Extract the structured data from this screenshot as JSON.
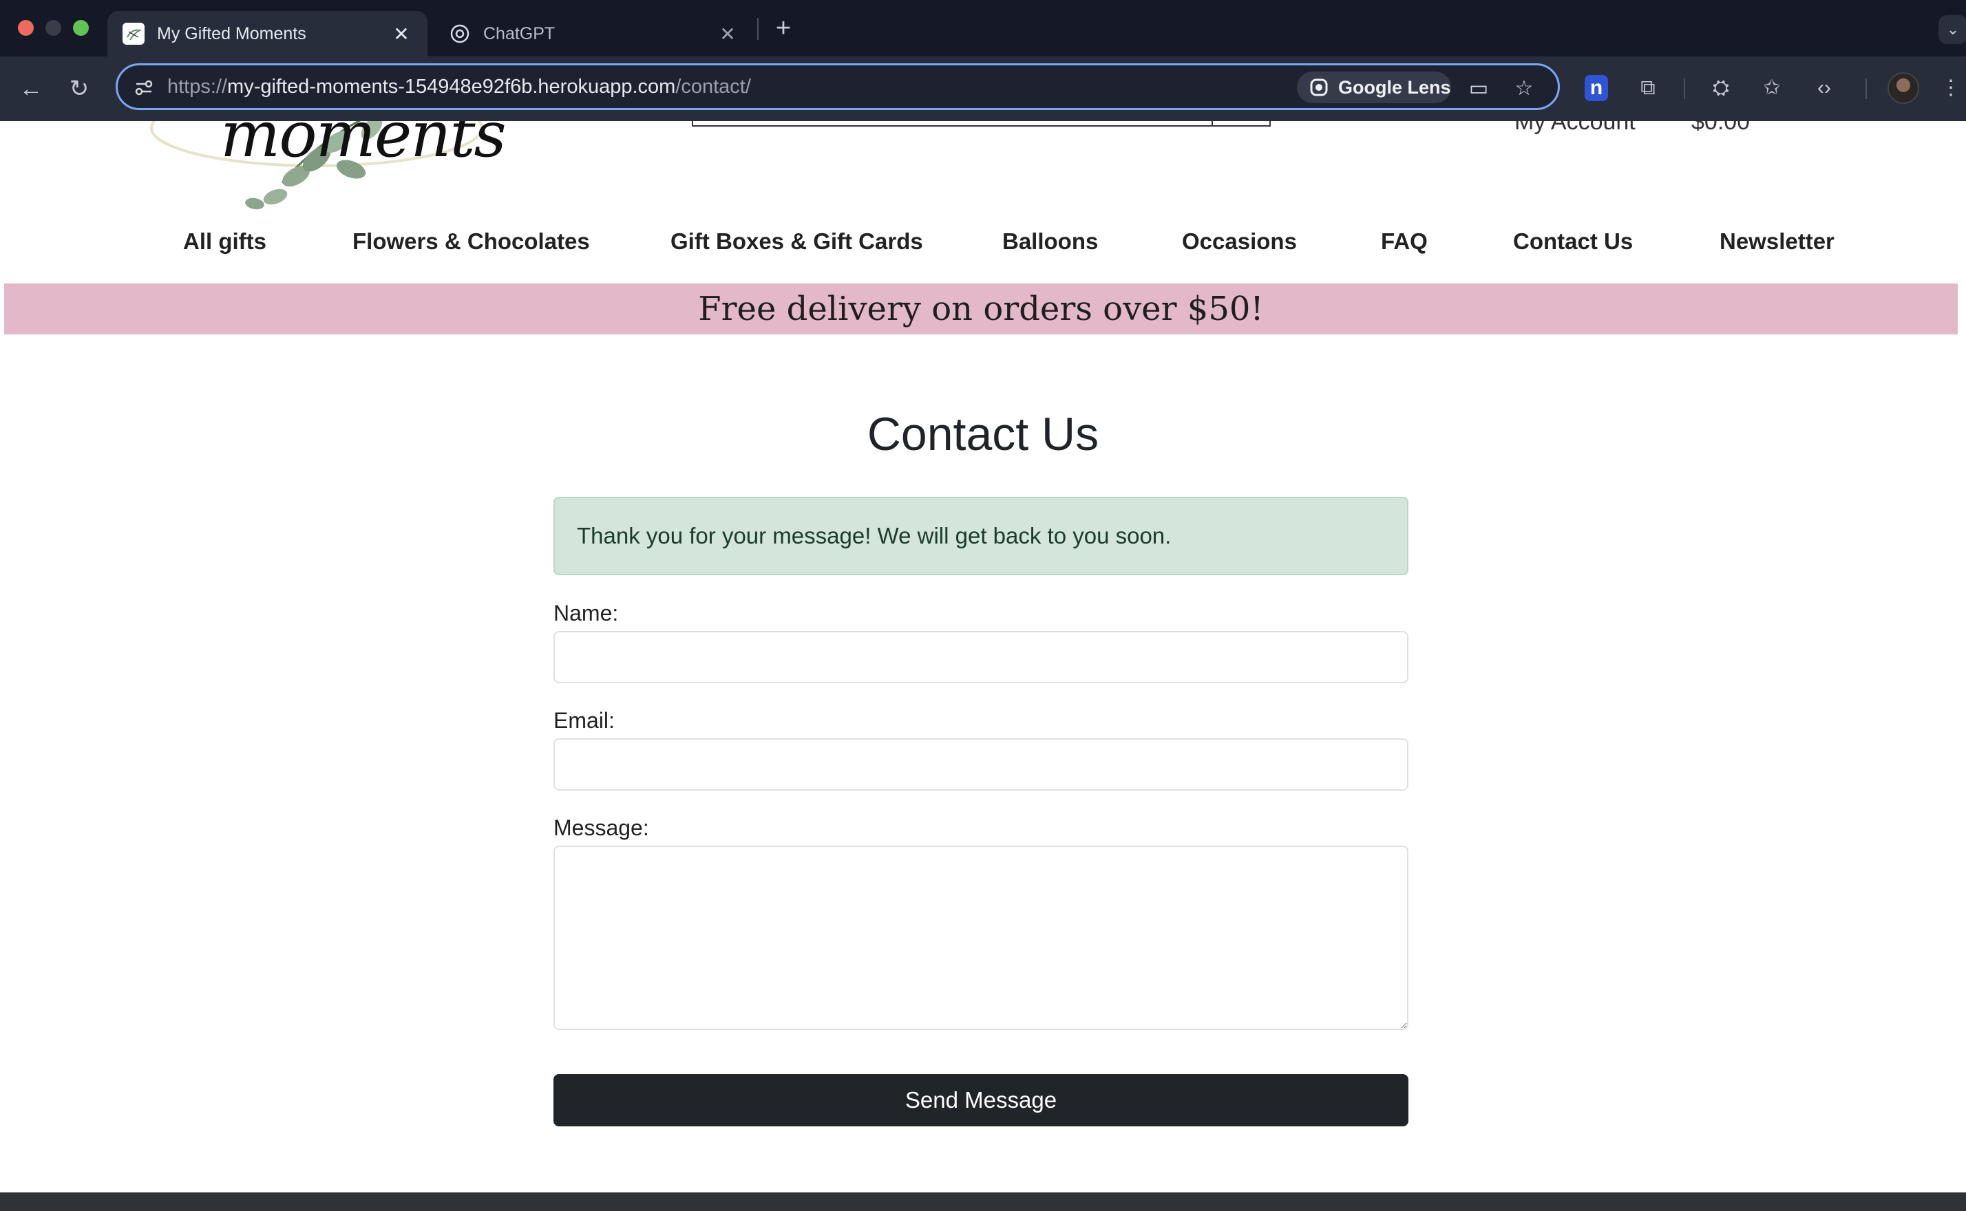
{
  "browser": {
    "tabs": [
      {
        "title": "My Gifted Moments",
        "active": true
      },
      {
        "title": "ChatGPT",
        "active": false
      }
    ],
    "url": {
      "scheme": "https://",
      "host": "my-gifted-moments-154948e92f6b.herokuapp.com",
      "path": "/contact/"
    },
    "lens_label": "Google Lens"
  },
  "site": {
    "logo_text": "moments",
    "account_label": "My Account",
    "cart_total": "$0.00",
    "nav": [
      "All gifts",
      "Flowers & Chocolates",
      "Gift Boxes & Gift Cards",
      "Balloons",
      "Occasions",
      "FAQ",
      "Contact Us",
      "Newsletter"
    ],
    "promo": "Free delivery on orders over $50!"
  },
  "contact": {
    "title": "Contact Us",
    "success_message": "Thank you for your message! We will get back to you soon.",
    "name_label": "Name:",
    "name_value": "",
    "email_label": "Email:",
    "email_value": "",
    "message_label": "Message:",
    "message_value": "",
    "submit_label": "Send Message"
  },
  "colors": {
    "promo_bg": "#e3b8c8",
    "alert_bg": "#d4e6dc",
    "button_bg": "#212529",
    "chrome_bg": "#141827"
  }
}
